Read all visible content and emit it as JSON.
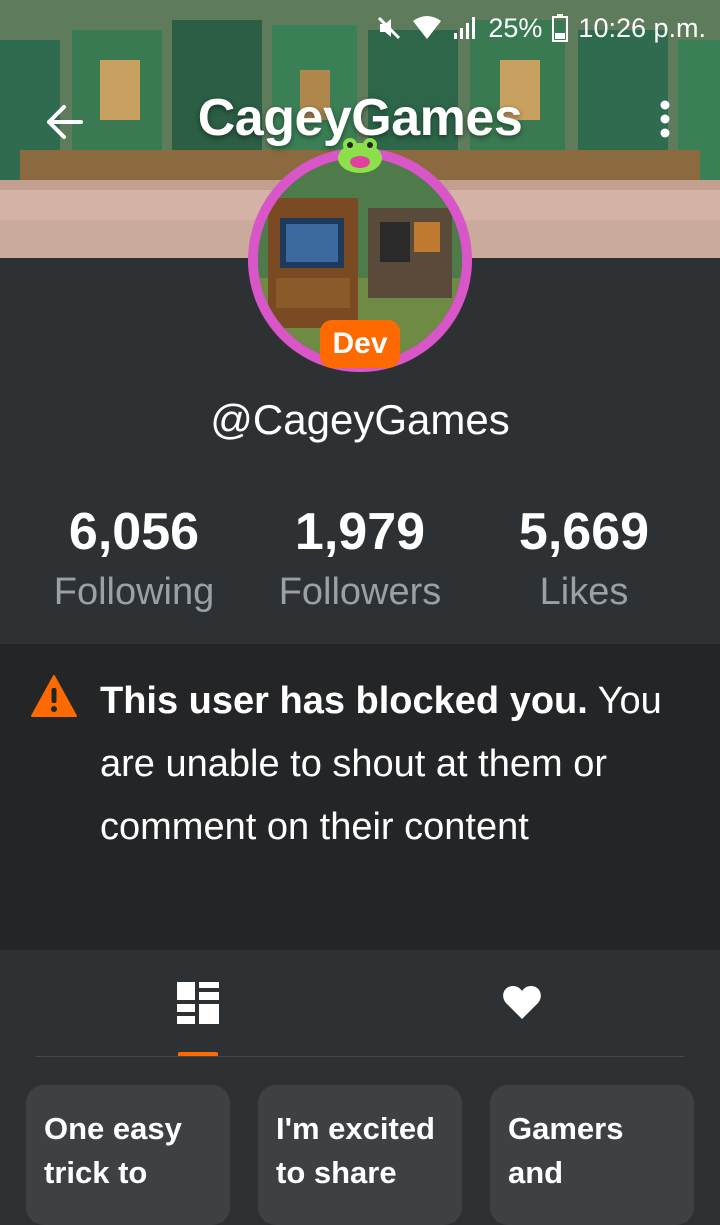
{
  "status_bar": {
    "battery": "25%",
    "time": "10:26 p.m.",
    "icons": [
      "mute-icon",
      "wifi-icon",
      "signal-icon",
      "battery-icon"
    ]
  },
  "header": {
    "title": "CageyGames",
    "back_icon": "arrow-left-icon",
    "more_icon": "more-vertical-icon"
  },
  "profile": {
    "badge": "Dev",
    "handle": "@CageyGames"
  },
  "stats": [
    {
      "value": "6,056",
      "label": "Following"
    },
    {
      "value": "1,979",
      "label": "Followers"
    },
    {
      "value": "5,669",
      "label": "Likes"
    }
  ],
  "notice": {
    "icon": "warning-icon",
    "bold": "This user has blocked you.",
    "text": "You are unable to shout at them or comment on their content"
  },
  "tabs": [
    {
      "icon": "grid-icon",
      "active": true
    },
    {
      "icon": "heart-icon",
      "active": false
    }
  ],
  "cards": [
    {
      "title": "One easy trick to"
    },
    {
      "title": "I'm excited to share"
    },
    {
      "title": "Gamers and"
    }
  ],
  "colors": {
    "accent": "#ff6a00",
    "background": "#2e3133",
    "notice_background": "#232527",
    "muted_text": "#9aa0a4",
    "avatar_ring": "#d956c9"
  }
}
